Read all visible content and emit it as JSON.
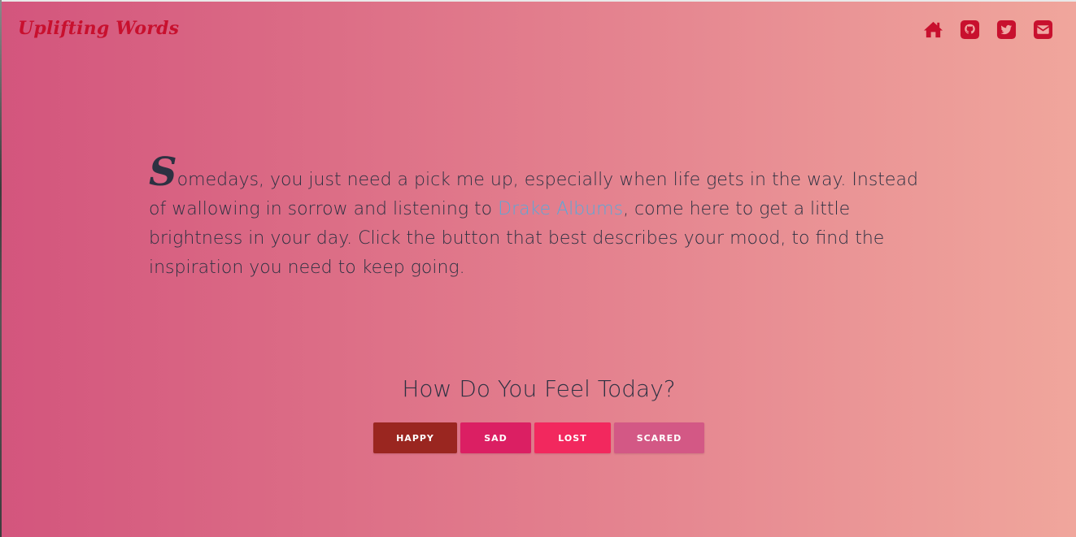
{
  "header": {
    "brand": "Uplifting Words",
    "icons": [
      {
        "name": "home-icon"
      },
      {
        "name": "github-icon"
      },
      {
        "name": "twitter-icon"
      },
      {
        "name": "email-icon"
      }
    ],
    "icon_color": "#c8102e"
  },
  "intro": {
    "dropcap": "S",
    "text_before_link": "omedays, you just need a pick me up, especially when life gets in the way. Instead of wallowing in sorrow and listening to ",
    "link_text": "Drake Albums",
    "text_after_link": ", come here to get a little brightness in your day. Click the button that best describes your mood, to find the inspiration you need to keep going."
  },
  "mood": {
    "heading": "How Do You Feel Today?",
    "buttons": [
      {
        "label": "HAPPY",
        "color": "#9a2620"
      },
      {
        "label": "SAD",
        "color": "#db1f63"
      },
      {
        "label": "LOST",
        "color": "#f2285e"
      },
      {
        "label": "SCARED",
        "color": "#d35885"
      }
    ]
  },
  "colors": {
    "background_start": "#d3557d",
    "background_end": "#f0a69c",
    "text": "#2d3142",
    "link": "#5aa8d8",
    "brand": "#c8102e"
  }
}
